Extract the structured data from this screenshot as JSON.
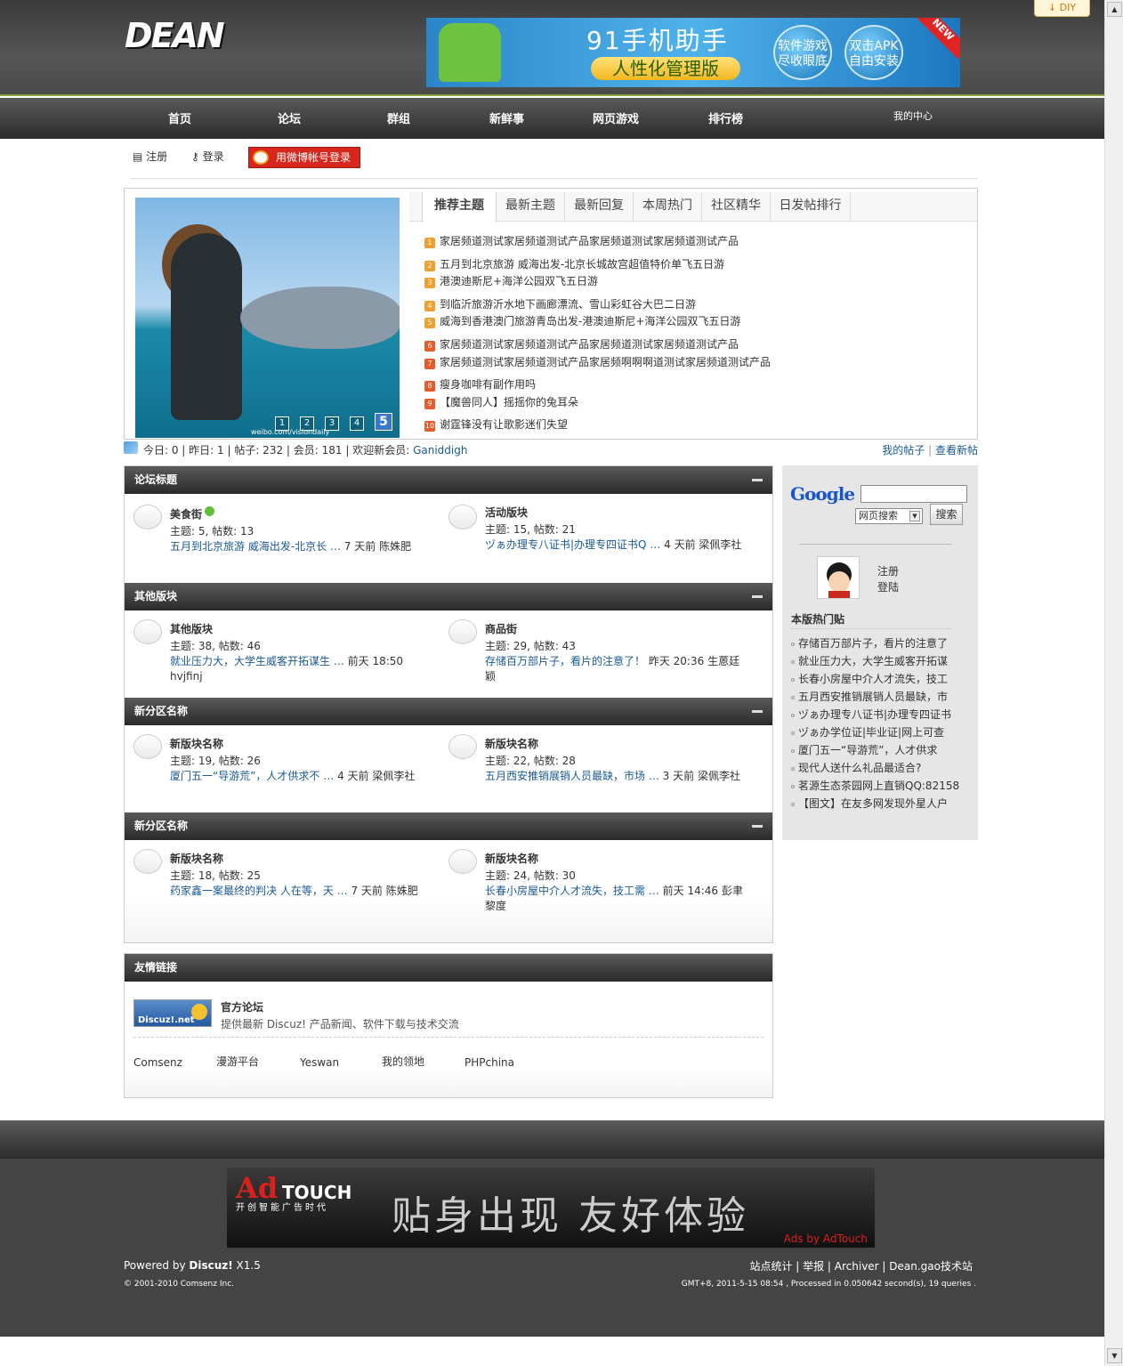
{
  "header": {
    "logo_text": "DEAN",
    "diy_label": "DIY",
    "ad": {
      "title": "91手机助手",
      "subtitle": "人性化管理版",
      "btn1": "软件游戏尽收眼底",
      "btn2": "双击APK自由安装",
      "badge": "NEW"
    }
  },
  "nav": {
    "items": [
      "首页",
      "论坛",
      "群组",
      "新鲜事",
      "网页游戏",
      "排行榜"
    ],
    "my_center": "我的中心"
  },
  "user_bar": {
    "register": "注册",
    "login": "登录",
    "weibo_login": "用微博帐号登录"
  },
  "slideshow": {
    "pages": [
      "1",
      "2",
      "3",
      "4",
      "5"
    ],
    "active_page": "5",
    "watermark": "weibo.com/visiondaily"
  },
  "tabs": [
    "推荐主题",
    "最新主题",
    "最新回复",
    "本周热门",
    "社区精华",
    "日发帖排行"
  ],
  "topics": [
    {
      "n": "1",
      "t": "家居频道测试家居频道测试产品家居频道测试家居频道测试产品"
    },
    {
      "n": "2",
      "t": "五月到北京旅游 威海出发-北京长城故宫超值特价单飞五日游"
    },
    {
      "n": "3",
      "t": "港澳迪斯尼+海洋公园双飞五日游"
    },
    {
      "n": "4",
      "t": "到临沂旅游沂水地下画廊漂流、雪山彩虹谷大巴二日游"
    },
    {
      "n": "5",
      "t": "威海到香港澳门旅游青岛出发-港澳迪斯尼+海洋公园双飞五日游"
    },
    {
      "n": "6",
      "t": "家居频道测试家居频道测试产品家居频道测试家居频道测试产品"
    },
    {
      "n": "7",
      "t": "家居频道测试家居频道测试产品家居频啊啊啊道测试家居频道测试产品"
    },
    {
      "n": "8",
      "t": "瘦身咖啡有副作用吗"
    },
    {
      "n": "9",
      "t": "【魔兽同人】摇摇你的兔耳朵"
    },
    {
      "n": "10",
      "t": "谢霆锋没有让歌影迷们失望"
    }
  ],
  "stats": {
    "text": "今日: 0 | 昨日: 1 | 帖子: 232 | 会员: 181 | 欢迎新会员: ",
    "new_member": "Ganiddigh",
    "my_posts": "我的帖子",
    "new_posts": "查看新帖"
  },
  "categories": [
    {
      "title": "论坛标题",
      "forums": [
        {
          "name": "美食街",
          "counts": "主题: 5, 帖数: 13",
          "last_title": "五月到北京旅游 威海出发-北京长 …",
          "last_time": "7 天前",
          "last_user": "陈姝肥",
          "verified": true
        },
        {
          "name": "活动版块",
          "counts": "主题: 15, 帖数: 21",
          "last_title": "ヅぁ办理专八证书|办理专四证书Q …",
          "last_time": "4 天前",
          "last_user": "梁佩李社"
        }
      ]
    },
    {
      "title": "其他版块",
      "forums": [
        {
          "name": "其他版块",
          "counts": "主题: 38, 帖数: 46",
          "last_title": "就业压力大，大学生威客开拓谋生 …",
          "last_time": "前天 18:50",
          "last_user": "hvjfinj"
        },
        {
          "name": "商品街",
          "counts": "主题: 29, 帖数: 43",
          "last_title": "存储百万部片子，看片的注意了！",
          "last_time": "昨天 20:36",
          "last_user": "生蒽廷颖"
        }
      ]
    },
    {
      "title": "新分区名称",
      "forums": [
        {
          "name": "新版块名称",
          "counts": "主题: 19, 帖数: 26",
          "last_title": "厦门五一“导游荒”，人才供求不 …",
          "last_time": "4 天前",
          "last_user": "梁佩李社"
        },
        {
          "name": "新版块名称",
          "counts": "主题: 22, 帖数: 28",
          "last_title": "五月西安推销展销人员最缺，市场 …",
          "last_time": "3 天前",
          "last_user": "梁佩李社"
        }
      ]
    },
    {
      "title": "新分区名称",
      "forums": [
        {
          "name": "新版块名称",
          "counts": "主题: 18, 帖数: 25",
          "last_title": "药家鑫一案最终的判决 人在等，天 …",
          "last_time": "7 天前",
          "last_user": "陈姝肥"
        },
        {
          "name": "新版块名称",
          "counts": "主题: 24, 帖数: 30",
          "last_title": "长春小房屋中介人才流失，技工需 …",
          "last_time": "前天 14:46",
          "last_user": "彭聿黎度"
        }
      ]
    }
  ],
  "friend_links": {
    "title": "友情链接",
    "logo_text": "Discuz!.net",
    "official_name": "官方论坛",
    "official_desc": "提供最新 Discuz! 产品新闻、软件下载与技术交流",
    "text_links": [
      "Comsenz",
      "漫游平台",
      "Yeswan",
      "我的领地",
      "PHPchina"
    ]
  },
  "sidebar": {
    "google_logo": "Google",
    "search_type": "网页搜索",
    "search_button": "搜索",
    "register": "注册",
    "login": "登陆",
    "hot_title": "本版热门贴",
    "hot_items": [
      "存储百万部片子，看片的注意了",
      "就业压力大，大学生威客开拓谋",
      "长春小房屋中介人才流失，技工",
      "五月西安推销展销人员最缺，市",
      "ヅぁ办理专八证书|办理专四证书",
      "ヅぁ办学位证|毕业证|网上可查",
      "厦门五一“导游荒”，人才供求",
      "现代人送什么礼品最适合?",
      "茗源生态茶园网上直销QQ:82158",
      "【图文】在友多网发现外星人户"
    ]
  },
  "footer": {
    "ad": {
      "brand_ad": "Ad",
      "brand_touch": "TOUCH",
      "tagline": "开创智能广告时代",
      "slogan": "贴身出现  友好体验",
      "by": "Ads by AdTouch"
    },
    "powered_prefix": "Powered by ",
    "powered_name": "Discuz!",
    "powered_ver": " X1.5",
    "copyright": "© 2001-2010 Comsenz Inc.",
    "links": "站点统计 | 举报 | Archiver | Dean.gao技术站",
    "timing": "GMT+8, 2011-5-15 08:54 , Processed in 0.050642 second(s), 19 queries ."
  }
}
